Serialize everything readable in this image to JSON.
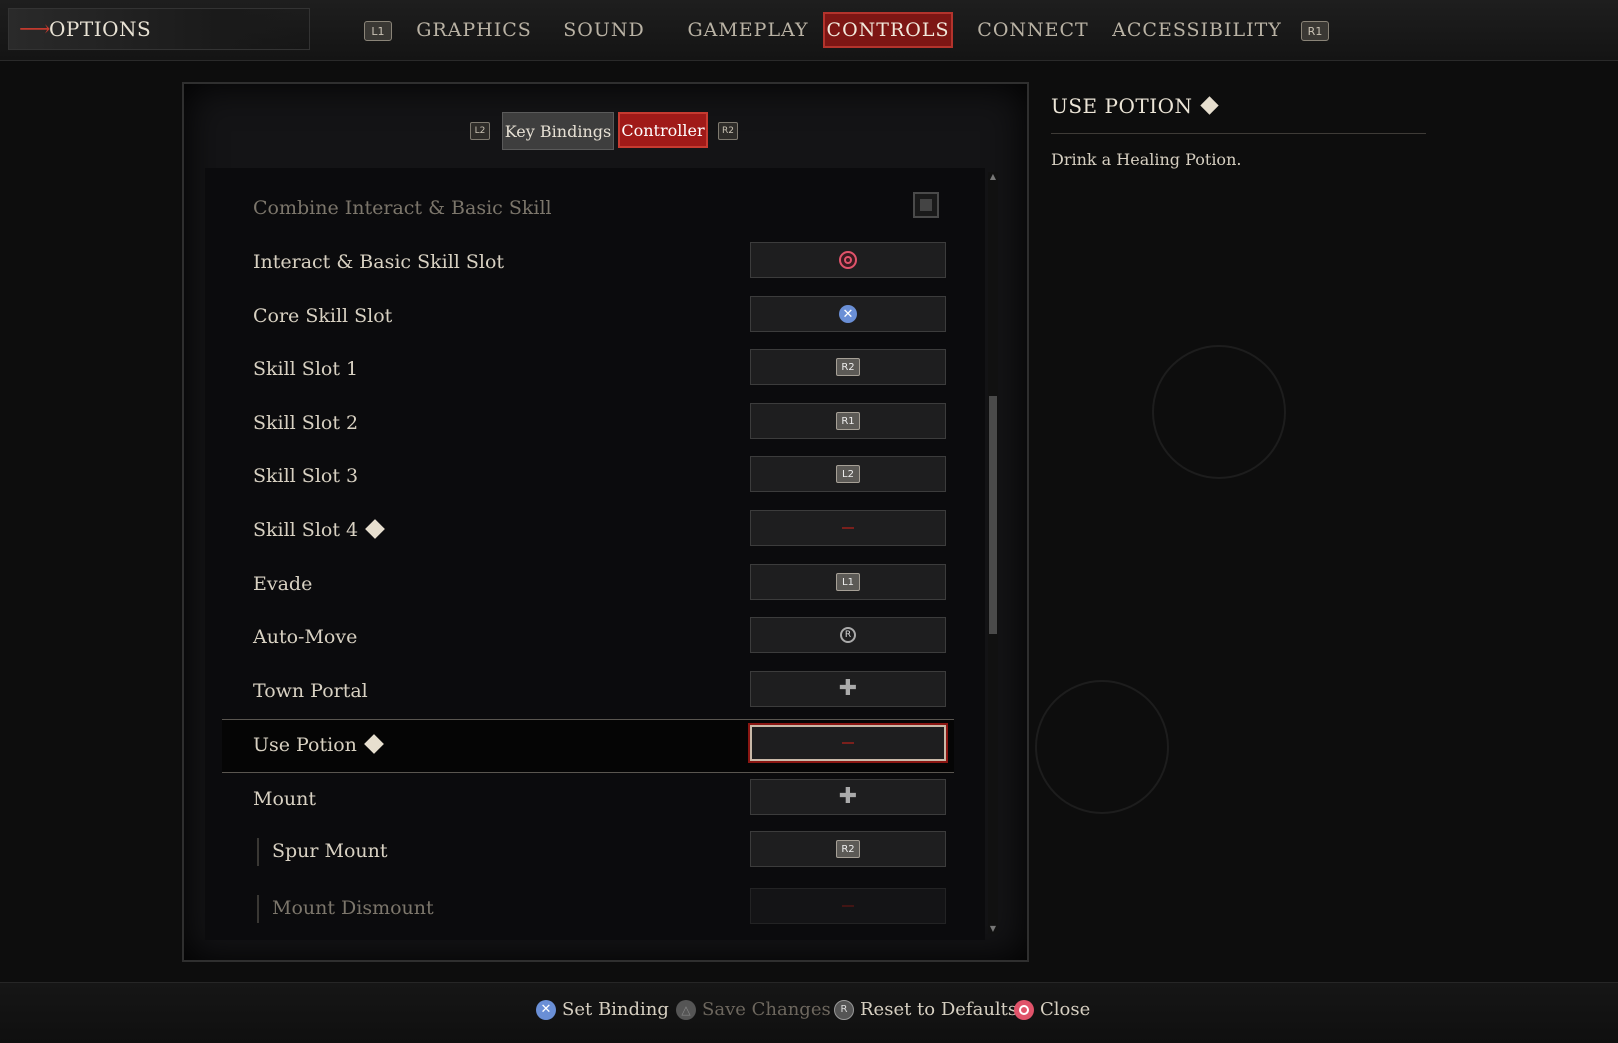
{
  "topbar": {
    "options_label": "OPTIONS",
    "prev_shoulder": "L1",
    "next_shoulder": "R1",
    "tabs": [
      {
        "label": "GRAPHICS",
        "active": false
      },
      {
        "label": "SOUND",
        "active": false
      },
      {
        "label": "GAMEPLAY",
        "active": false
      },
      {
        "label": "CONTROLS",
        "active": true
      },
      {
        "label": "CONNECT",
        "active": false
      },
      {
        "label": "ACCESSIBILITY",
        "active": false
      }
    ]
  },
  "subtabs": {
    "prev_trigger": "L2",
    "next_trigger": "R2",
    "key_bindings": "Key Bindings",
    "controller": "Controller"
  },
  "bindings": [
    {
      "label": "Combine Interact & Basic Skill",
      "binding": "checkbox",
      "dim": true
    },
    {
      "label": "Interact & Basic Skill Slot",
      "binding": "circle-button"
    },
    {
      "label": "Core Skill Slot",
      "binding": "cross-button"
    },
    {
      "label": "Skill Slot 1",
      "binding": "R2"
    },
    {
      "label": "Skill Slot 2",
      "binding": "R1"
    },
    {
      "label": "Skill Slot 3",
      "binding": "L2"
    },
    {
      "label": "Skill Slot 4",
      "binding": "unbound",
      "warning": true
    },
    {
      "label": "Evade",
      "binding": "L1"
    },
    {
      "label": "Auto-Move",
      "binding": "R"
    },
    {
      "label": "Town Portal",
      "binding": "dpad"
    },
    {
      "label": "Use Potion",
      "binding": "unbound",
      "warning": true,
      "selected": true
    },
    {
      "label": "Mount",
      "binding": "dpad"
    },
    {
      "label": "Spur Mount",
      "binding": "R2",
      "sub": true
    },
    {
      "label": "Mount Dismount",
      "binding": "unbound",
      "sub": true,
      "dim": true
    }
  ],
  "info": {
    "title": "USE POTION",
    "description": "Drink a Healing Potion."
  },
  "footer": {
    "set_binding": "Set Binding",
    "save_changes": "Save Changes",
    "reset_defaults": "Reset to Defaults",
    "close": "Close",
    "reset_icon_letter": "R"
  },
  "colors": {
    "accent_red": "#a01a18",
    "cross_blue": "#6a8fd6",
    "circle_pink": "#e0536a"
  }
}
